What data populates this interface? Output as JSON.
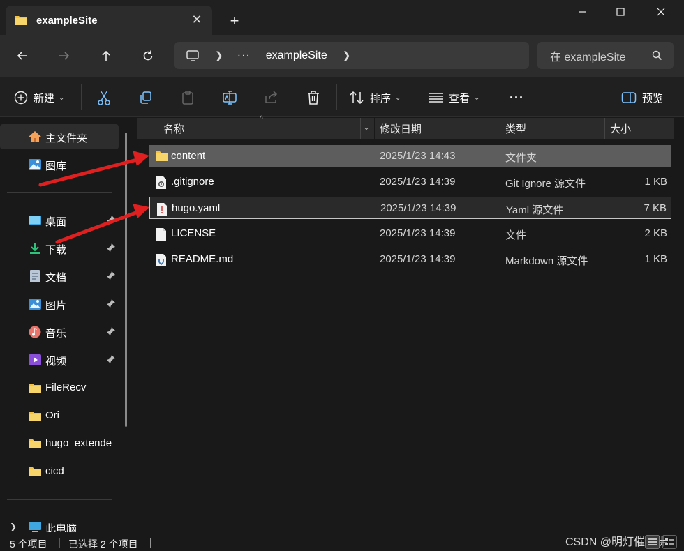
{
  "window": {
    "tab_title": "exampleSite",
    "new_tab_symbol": "+",
    "close_tab_symbol": "✕"
  },
  "address": {
    "ellipsis": "···",
    "crumb": "exampleSite",
    "search_placeholder": "在 exampleSite"
  },
  "toolbar": {
    "new_label": "新建",
    "sort_label": "排序",
    "view_label": "查看",
    "more_label": "···",
    "preview_label": "预览"
  },
  "sidebar": {
    "items": [
      {
        "label": "主文件夹",
        "icon": "home-icon",
        "pinned": false,
        "selected": true
      },
      {
        "label": "图库",
        "icon": "gallery-icon",
        "pinned": false,
        "selected": false
      },
      {
        "label": "桌面",
        "icon": "desktop-icon",
        "pinned": true,
        "selected": false
      },
      {
        "label": "下载",
        "icon": "download-icon",
        "pinned": true,
        "selected": false
      },
      {
        "label": "文档",
        "icon": "document-icon",
        "pinned": true,
        "selected": false
      },
      {
        "label": "图片",
        "icon": "pictures-icon",
        "pinned": true,
        "selected": false
      },
      {
        "label": "音乐",
        "icon": "music-icon",
        "pinned": true,
        "selected": false
      },
      {
        "label": "视频",
        "icon": "video-icon",
        "pinned": true,
        "selected": false
      },
      {
        "label": "FileRecv",
        "icon": "folder-icon",
        "pinned": false,
        "selected": false
      },
      {
        "label": "Ori",
        "icon": "folder-icon",
        "pinned": false,
        "selected": false
      },
      {
        "label": "hugo_extende",
        "icon": "folder-icon",
        "pinned": false,
        "selected": false
      },
      {
        "label": "cicd",
        "icon": "folder-icon",
        "pinned": false,
        "selected": false
      },
      {
        "label": "此电脑",
        "icon": "this-pc-icon",
        "pinned": false,
        "selected": false
      }
    ]
  },
  "columns": {
    "name": "名称",
    "date": "修改日期",
    "type": "类型",
    "size": "大小"
  },
  "files": [
    {
      "name": "content",
      "date": "2025/1/23 14:43",
      "type": "文件夹",
      "size": "",
      "icon": "folder-icon",
      "state": "selected"
    },
    {
      "name": ".gitignore",
      "date": "2025/1/23 14:39",
      "type": "Git Ignore 源文件",
      "size": "1 KB",
      "icon": "settings-file-icon",
      "state": "normal"
    },
    {
      "name": "hugo.yaml",
      "date": "2025/1/23 14:39",
      "type": "Yaml 源文件",
      "size": "7 KB",
      "icon": "yaml-file-icon",
      "state": "focused"
    },
    {
      "name": "LICENSE",
      "date": "2025/1/23 14:39",
      "type": "文件",
      "size": "2 KB",
      "icon": "blank-file-icon",
      "state": "normal"
    },
    {
      "name": "README.md",
      "date": "2025/1/23 14:39",
      "type": "Markdown 源文件",
      "size": "1 KB",
      "icon": "markdown-file-icon",
      "state": "normal"
    }
  ],
  "status": {
    "count": "5 个项目",
    "selected": "已选择 2 个项目",
    "separator": "|"
  },
  "watermark": "CSDN @明灯催士佛",
  "colors": {
    "folder": "#f4c242",
    "arrow": "#e02020",
    "selection": "#5d5d5d",
    "background": "#191919"
  }
}
